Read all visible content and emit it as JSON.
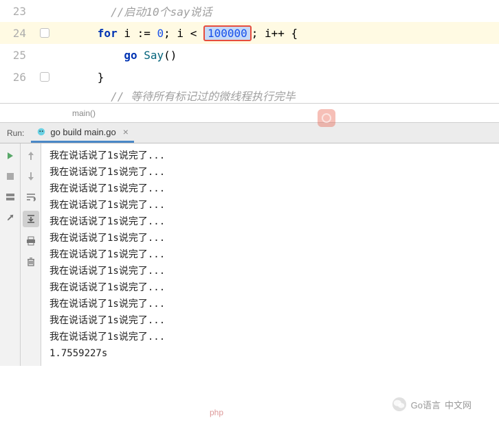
{
  "editor": {
    "lines": [
      {
        "num": "23",
        "comment": "//启动10个say说话"
      },
      {
        "num": "24",
        "code": {
          "kw1": "for",
          "var1": " i ",
          "op1": ":=",
          "sp1": " ",
          "n0": "0",
          "semi1": "; i < ",
          "n1": "100000",
          "semi2": "; i++ {"
        }
      },
      {
        "num": "25",
        "code": {
          "kw": "go",
          "sp": " ",
          "fn": "Say",
          "paren": "()"
        }
      },
      {
        "num": "26",
        "code": {
          "brace": "}"
        }
      }
    ],
    "truncated_hint": "// 等待所有标记过的微线程执行完毕"
  },
  "breadcrumb": "main()",
  "run": {
    "label": "Run:",
    "tab_name": "go build main.go",
    "console_lines": [
      "我在说话说了1s说完了...",
      "我在说话说了1s说完了...",
      "我在说话说了1s说完了...",
      "我在说话说了1s说完了...",
      "我在说话说了1s说完了...",
      "我在说话说了1s说完了...",
      "我在说话说了1s说完了...",
      "我在说话说了1s说完了...",
      "我在说话说了1s说完了...",
      "我在说话说了1s说完了...",
      "我在说话说了1s说完了...",
      "我在说话说了1s说完了..."
    ],
    "time": "1.7559227s"
  },
  "watermark": {
    "text": "Go语言",
    "text2": "中文网"
  },
  "watermark_center": "php"
}
